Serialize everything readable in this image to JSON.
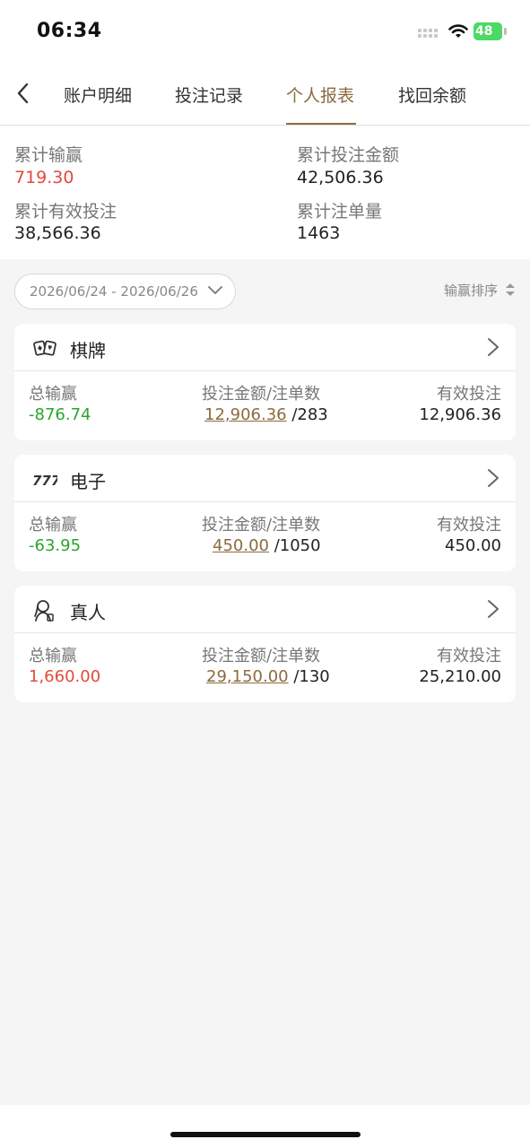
{
  "status_bar": {
    "time": "06:34",
    "battery": "48"
  },
  "nav": {
    "tabs": [
      {
        "label": "账户明细",
        "active": false
      },
      {
        "label": "投注记录",
        "active": false
      },
      {
        "label": "个人报表",
        "active": true
      },
      {
        "label": "找回余额",
        "active": false
      }
    ]
  },
  "summary": {
    "total_win_loss_label": "累计输赢",
    "total_win_loss_value": "719.30",
    "total_bet_amount_label": "累计投注金额",
    "total_bet_amount_value": "42,506.36",
    "total_valid_bet_label": "累计有效投注",
    "total_valid_bet_value": "38,566.36",
    "total_orders_label": "累计注单量",
    "total_orders_value": "1463"
  },
  "filter": {
    "date_range": "2026/06/24 - 2026/06/26",
    "sort_label": "输赢排序"
  },
  "categories": [
    {
      "title": "棋牌",
      "icon": "cards-icon",
      "win_loss_label": "总输赢",
      "win_loss_value": "-876.74",
      "bet_label": "投注金额/注单数",
      "bet_amount": "12,906.36",
      "order_count": " /283",
      "valid_bet_label": "有效投注",
      "valid_bet_value": "12,906.36"
    },
    {
      "title": "电子",
      "icon": "slot-777-icon",
      "win_loss_label": "总输赢",
      "win_loss_value": "-63.95",
      "bet_label": "投注金额/注单数",
      "bet_amount": "450.00",
      "order_count": " /1050",
      "valid_bet_label": "有效投注",
      "valid_bet_value": "450.00"
    },
    {
      "title": "真人",
      "icon": "live-dealer-icon",
      "win_loss_label": "总输赢",
      "win_loss_value": "1,660.00",
      "bet_label": "投注金额/注单数",
      "bet_amount": "29,150.00",
      "order_count": " /130",
      "valid_bet_label": "有效投注",
      "valid_bet_value": "25,210.00"
    }
  ],
  "colors": {
    "accent": "#8c6a3f",
    "loss": "#2aa52a",
    "gain": "#e5483b"
  }
}
